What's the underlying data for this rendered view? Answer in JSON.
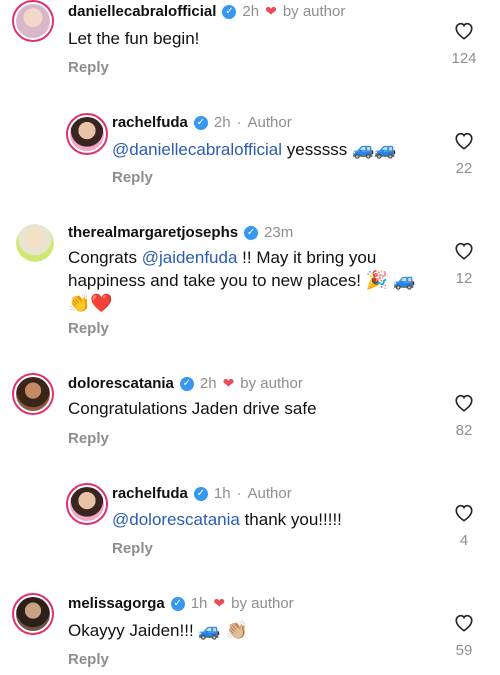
{
  "comments": [
    {
      "username": "daniellecabralofficial",
      "time": "2h",
      "liked_by": "by author",
      "text": "Let the fun begin!",
      "reply": "Reply",
      "likes": "124",
      "avatar_color": "#d9b7c9"
    },
    {
      "username": "rachelfuda",
      "time": "2h",
      "author": "Author",
      "mention": "@daniellecabralofficial",
      "text": " yesssss ",
      "emoji": "🚙🚙",
      "reply": "Reply",
      "likes": "22",
      "avatar_color": "#c58aa3"
    },
    {
      "username": "therealmargaretjosephs",
      "time": "23m",
      "text_before": "Congrats ",
      "mention": "@jaidenfuda",
      "text_after": " !! May it bring you happiness and take you to new places! ",
      "emoji": "🎉 🚙👏❤️",
      "reply": "Reply",
      "likes": "12",
      "avatar_color": "#cfe870"
    },
    {
      "username": "dolorescatania",
      "time": "2h",
      "liked_by": "by author",
      "text": "Congratulations Jaden drive safe",
      "reply": "Reply",
      "likes": "82",
      "avatar_color": "#8a5a3c"
    },
    {
      "username": "rachelfuda",
      "time": "1h",
      "author": "Author",
      "mention": "@dolorescatania",
      "text": " thank you!!!!!",
      "reply": "Reply",
      "likes": "4",
      "avatar_color": "#c58aa3"
    },
    {
      "username": "melissagorga",
      "time": "1h",
      "liked_by": "by author",
      "text": "Okayyy Jaiden!!! ",
      "emoji": "🚙 👏🏼",
      "reply": "Reply",
      "likes": "59",
      "avatar_color": "#6b5448"
    }
  ],
  "icons": {
    "verified": "verified-badge-icon",
    "like": "heart-outline-icon",
    "liked_by_author": "red-heart-icon"
  },
  "colors": {
    "accent_blue": "#3897f0",
    "mention": "#2a5db0",
    "heart_red": "#ed4956",
    "muted": "#8e8e8e"
  }
}
